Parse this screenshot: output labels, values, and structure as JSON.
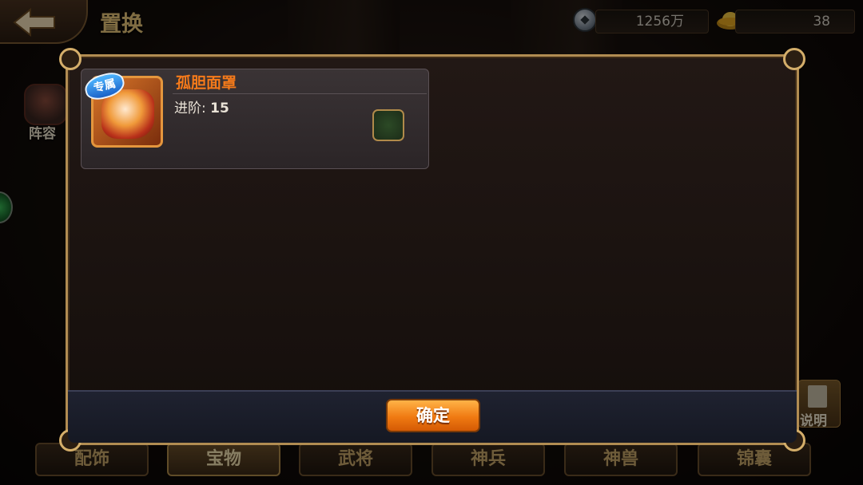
{
  "header": {
    "title": "置换"
  },
  "resources": {
    "coins": "1256万",
    "gold": "38"
  },
  "sidebar": {
    "team_label": "阵容"
  },
  "explain": {
    "label": "说明"
  },
  "tabs": [
    {
      "label": "配饰",
      "active": false
    },
    {
      "label": "宝物",
      "active": true
    },
    {
      "label": "武将",
      "active": false
    },
    {
      "label": "神兵",
      "active": false
    },
    {
      "label": "神兽",
      "active": false
    },
    {
      "label": "锦囊",
      "active": false
    }
  ],
  "dialog": {
    "item": {
      "badge": "专属",
      "name": "孤胆面罩",
      "level_label": "进阶:",
      "level_value": "15"
    },
    "confirm_label": "确定"
  },
  "colors": {
    "title": "#e9c77a",
    "item_name": "#f57a1a",
    "confirm_button": "#f07a12",
    "dialog_border": "#b18c52"
  }
}
